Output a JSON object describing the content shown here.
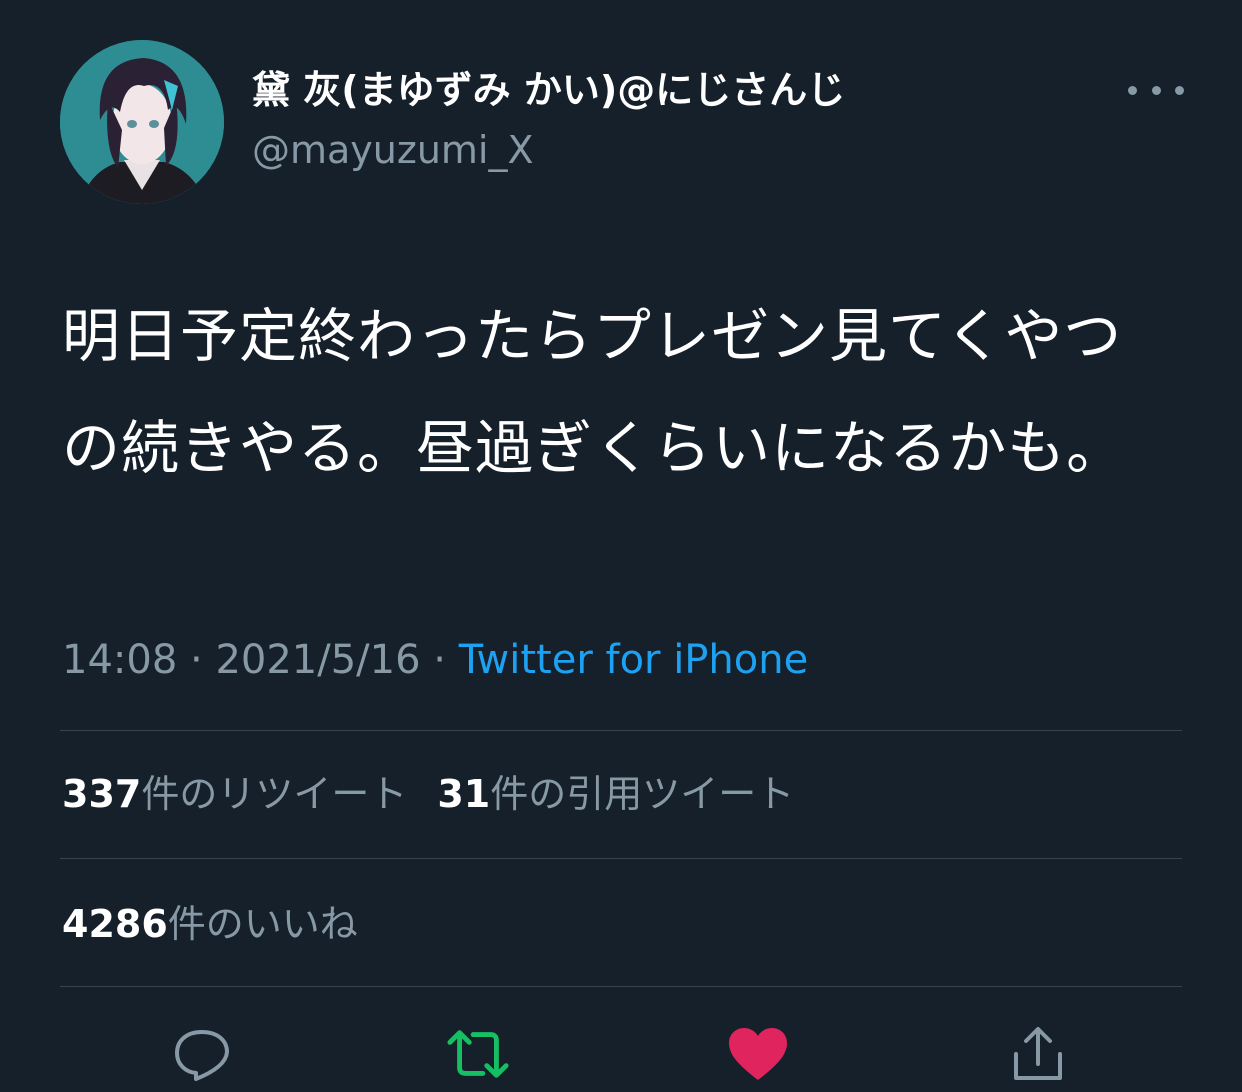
{
  "author": {
    "display_name": "黛 灰(まゆずみ かい)@にじさんじ",
    "handle": "@mayuzumi_X"
  },
  "tweet": {
    "text": "明日予定終わったらプレゼン見てくやつの続きやる。昼過ぎくらいになるかも。",
    "time": "14:08",
    "separator": "·",
    "date": "2021/5/16",
    "source": "Twitter for iPhone"
  },
  "stats": {
    "retweets_count": "337",
    "retweets_label": "件のリツイート",
    "quotes_count": "31",
    "quotes_label": "件の引用ツイート",
    "likes_count": "4286",
    "likes_label": "件のいいね"
  },
  "actions": {
    "reply_icon": "reply-icon",
    "retweet_icon": "retweet-icon",
    "like_icon": "heart-icon",
    "share_icon": "share-icon"
  },
  "colors": {
    "background": "#15202b",
    "secondary_text": "#8899a6",
    "link": "#1da1f2",
    "retweet_active": "#17bf63",
    "like_active": "#e0245e",
    "divider": "#38444d"
  }
}
